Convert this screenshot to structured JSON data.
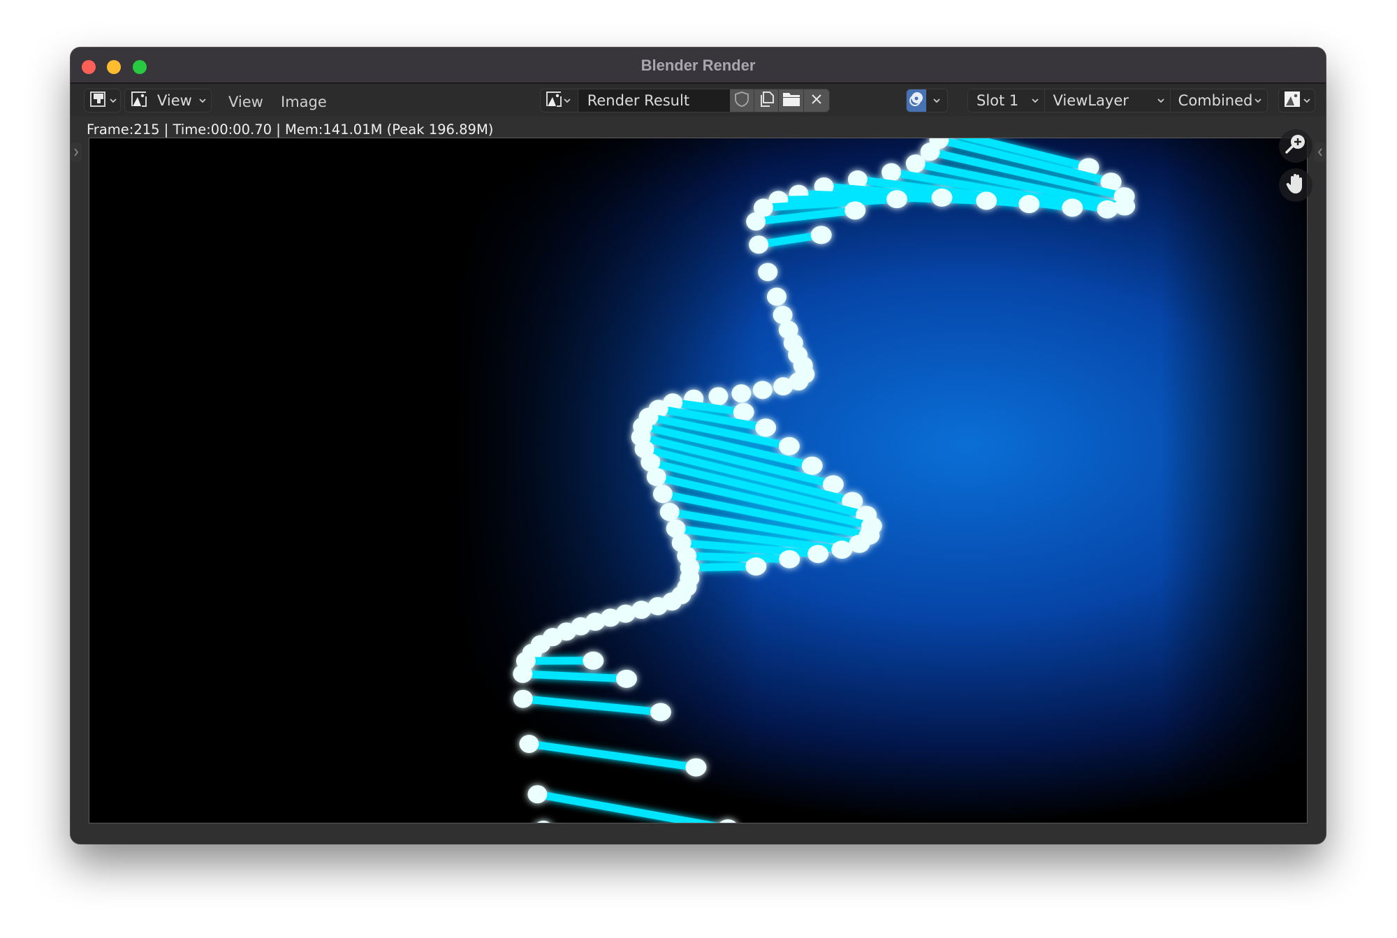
{
  "window": {
    "title": "Blender Render",
    "traffic_lights": [
      "close",
      "minimize",
      "maximize"
    ]
  },
  "toolbar": {
    "editor_type": {
      "icon": "image-editor-icon"
    },
    "mode_dropdown": {
      "icon": "image-icon",
      "label": "View"
    },
    "menus": [
      {
        "label": "View"
      },
      {
        "label": "Image"
      }
    ],
    "image_browser": {
      "icon": "image-icon"
    },
    "image_name": "Render Result",
    "image_actions": [
      {
        "name": "fake-user",
        "icon": "shield-icon"
      },
      {
        "name": "duplicate",
        "icon": "copy-icon"
      },
      {
        "name": "open",
        "icon": "folder-icon"
      },
      {
        "name": "unlink",
        "icon": "close-icon"
      }
    ],
    "pin_toggle": {
      "icon": "render-slot-icon",
      "active": true,
      "accent": "#4772b3"
    },
    "slot": "Slot 1",
    "view_layer": "ViewLayer",
    "pass": "Combined",
    "display_channels": {
      "icon": "color-alpha-icon"
    }
  },
  "status": {
    "info": "Frame:215 | Time:00:00.70 | Mem:141.01M (Peak 196.89M)"
  },
  "viewport": {
    "image_content": "Glowing cyan DNA double helix on dark blue background",
    "nav_buttons": [
      {
        "name": "zoom",
        "icon": "zoom-in-icon"
      },
      {
        "name": "pan",
        "icon": "hand-icon"
      }
    ],
    "colors": {
      "strand": "#00e5ff",
      "node": "#eafffe",
      "glow": "#0a6fd6",
      "background": "#000000"
    }
  }
}
